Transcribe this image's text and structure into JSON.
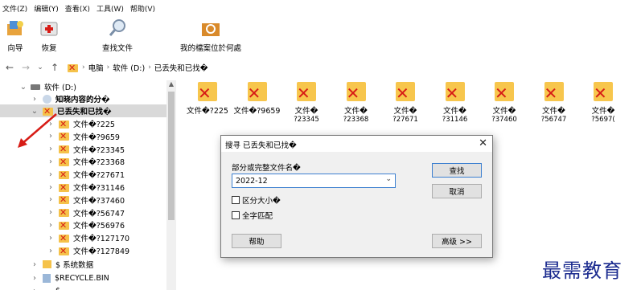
{
  "menu": [
    "文件(Z)",
    "编辑(Y)",
    "查看(X)",
    "工具(W)",
    "帮助(V)"
  ],
  "toolbar": {
    "wizard": "向导",
    "restore": "恢复",
    "find_files": "查找文件",
    "locate": "我的檔案位於何處"
  },
  "address": {
    "crumbs": [
      "电脑",
      "软件 (D:)",
      "已丢失和已找�"
    ]
  },
  "tree": {
    "drive": "软件 (D:)",
    "known": "知晓内容的分�",
    "lost": "已丢失和已找�",
    "items": [
      "文件�?225",
      "文件�?9659",
      "文件�?23345",
      "文件�?23368",
      "文件�?27671",
      "文件�?31146",
      "文件�?37460",
      "文件�?56747",
      "文件�?56976",
      "文件�?127170",
      "文件�?127849"
    ],
    "system": "$ 系统数据",
    "recycle": "$RECYCLE.BIN",
    "cut": "$..."
  },
  "files": [
    {
      "l1": "文件�?225",
      "l2": ""
    },
    {
      "l1": "文件�?9659",
      "l2": ""
    },
    {
      "l1": "文件�",
      "l2": "?23345"
    },
    {
      "l1": "文件�",
      "l2": "?23368"
    },
    {
      "l1": "文件�",
      "l2": "?27671"
    },
    {
      "l1": "文件�",
      "l2": "?31146"
    },
    {
      "l1": "文件�",
      "l2": "?37460"
    },
    {
      "l1": "文件�",
      "l2": "?56747"
    },
    {
      "l1": "文件�",
      "l2": "?5697("
    }
  ],
  "dialog": {
    "title": "搜寻 已丢失和已找�",
    "label": "部分或完整文件名�",
    "input": "2022-12",
    "case": "区分大小�",
    "whole": "全字匹配",
    "find": "查找",
    "cancel": "取消",
    "help": "帮助",
    "advanced": "高级 >>"
  },
  "watermark": "最需教育",
  "colors": {
    "accent_red": "#d71c16",
    "folder": "#f5c24a",
    "selection": "#d9d9d9"
  }
}
